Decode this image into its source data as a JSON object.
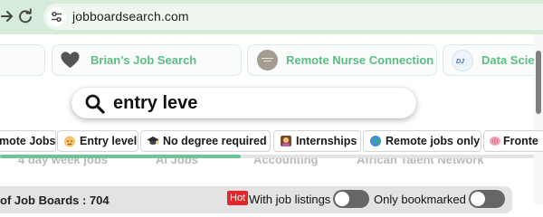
{
  "browser": {
    "url": "jobboardsearch.com"
  },
  "cards": [
    {
      "label": "",
      "icon": "partial-card-left"
    },
    {
      "label": "Brian's Job Search",
      "icon": "heart-icon"
    },
    {
      "label": "Remote Nurse Connection",
      "icon": "nurse-logo"
    },
    {
      "label": "Data Scien",
      "icon": "data-logo"
    }
  ],
  "search": {
    "value": "entry leve"
  },
  "chips": [
    {
      "label": "mote Jobs",
      "icon": ""
    },
    {
      "label": "Entry level",
      "icon": "baby-emoji"
    },
    {
      "label": "No degree required",
      "icon": "graduation-cap-emoji"
    },
    {
      "label": "Internships",
      "icon": "person-emoji"
    },
    {
      "label": "Remote jobs only",
      "icon": "globe-emoji"
    },
    {
      "label": "Fronte",
      "icon": "brain-emoji"
    }
  ],
  "faded_row": [
    "4 day week jobs",
    "AI Jobs",
    "Accounting",
    "African Talent Network"
  ],
  "scroll_progress": 0.45,
  "filters": {
    "count_label": "of Job Boards : 704",
    "hot_badge": "Hot",
    "with_listings_label": "With job listings",
    "only_bookmarked_label": "Only bookmarked"
  },
  "colors": {
    "chrome_bg": "#d6ebd9",
    "accent_green": "#5bbd83",
    "hot_red": "#e8242b"
  }
}
